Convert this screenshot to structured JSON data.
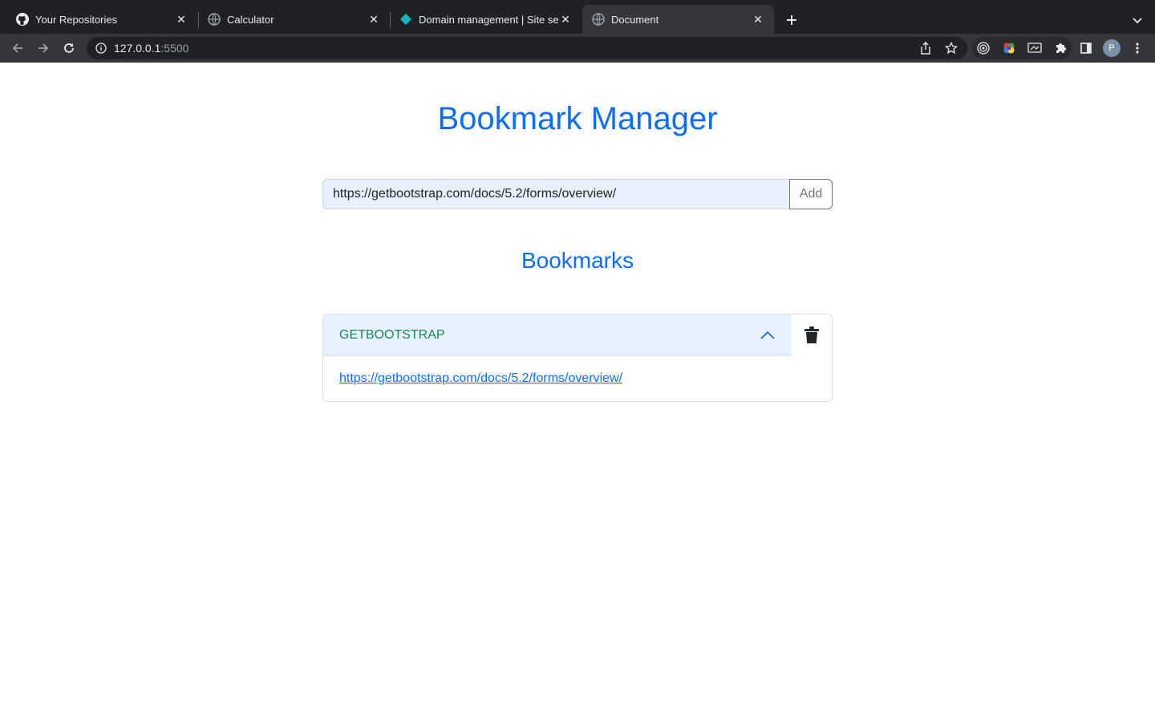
{
  "browser": {
    "tabs": [
      {
        "title": "Your Repositories",
        "icon": "github-icon",
        "active": false
      },
      {
        "title": "Calculator",
        "icon": "globe-icon",
        "active": false
      },
      {
        "title": "Domain management | Site settings",
        "icon": "netlify-icon",
        "active": false
      },
      {
        "title": "Document",
        "icon": "globe-icon",
        "active": true
      }
    ],
    "address": {
      "host": "127.0.0.1",
      "port": ":5500"
    },
    "profile_initial": "P"
  },
  "app": {
    "title": "Bookmark Manager",
    "input": {
      "value": "https://getbootstrap.com/docs/5.2/forms/overview/",
      "placeholder": ""
    },
    "add_label": "Add",
    "bookmarks_heading": "Bookmarks",
    "bookmarks": [
      {
        "name": "GETBOOTSTRAP",
        "url": "https://getbootstrap.com/docs/5.2/forms/overview/",
        "expanded": true
      }
    ]
  },
  "colors": {
    "primary": "#0d6efd",
    "bookmark_name": "#198754",
    "header_bg": "#e7f1ff",
    "input_bg": "#e8f0fe",
    "chrome_dark": "#202124",
    "chrome_toolbar": "#35363a"
  }
}
